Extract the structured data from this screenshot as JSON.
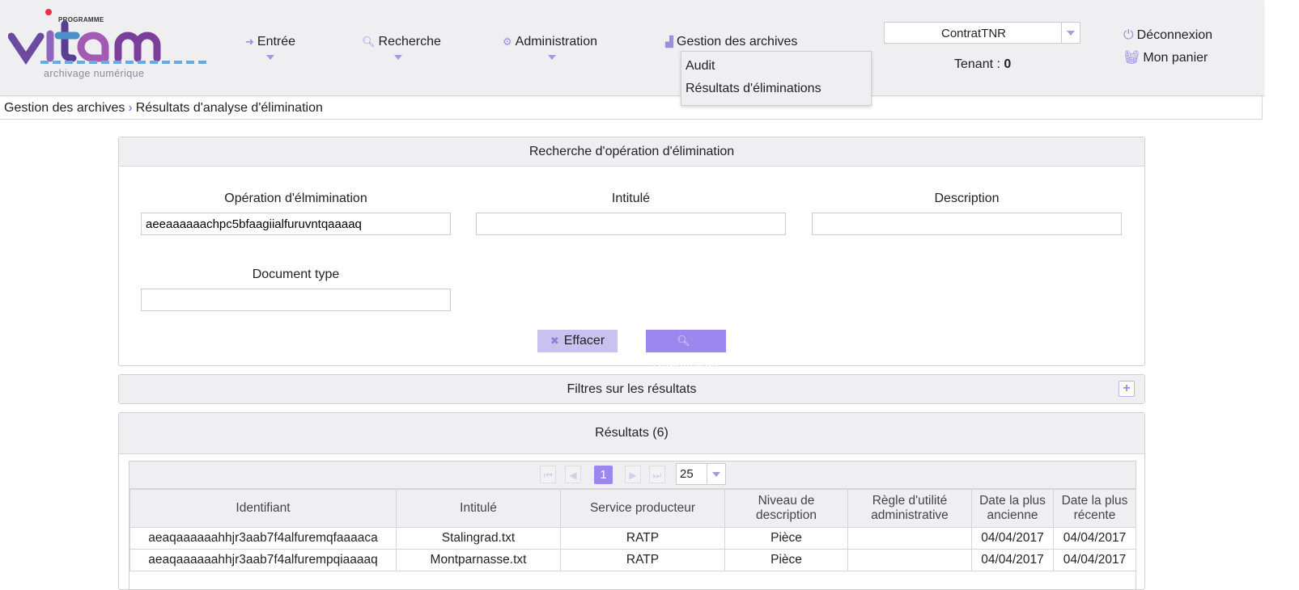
{
  "logo": {
    "program_label": "PROGRAMME",
    "brand": "vitam",
    "tagline": "archivage numérique"
  },
  "nav": {
    "items": [
      {
        "label": "Entrée",
        "icon": "sign-in-icon"
      },
      {
        "label": "Recherche",
        "icon": "search-icon"
      },
      {
        "label": "Administration",
        "icon": "gears-icon"
      },
      {
        "label": "Gestion des archives",
        "icon": "area-chart-icon"
      }
    ],
    "dropdown": [
      "Audit",
      "Résultats d'éliminations"
    ]
  },
  "header": {
    "contract": "ContratTNR",
    "tenant_label": "Tenant :",
    "tenant_value": "0",
    "logout": "Déconnexion",
    "cart": "Mon panier"
  },
  "breadcrumb": {
    "parent": "Gestion des archives",
    "current": "Résultats d'analyse d'élimination"
  },
  "search": {
    "title": "Recherche d'opération d'élimination",
    "operation_label": "Opération d'élmimination",
    "operation_value": "aeeaaaaaachpc5bfaagiialfuruvntqaaaaq",
    "title_label": "Intitulé",
    "title_value": "",
    "description_label": "Description",
    "description_value": "",
    "doctype_label": "Document type",
    "doctype_value": "",
    "clear_button": "Effacer",
    "search_button": "Rechercher"
  },
  "filters": {
    "title": "Filtres sur les résultats",
    "toggle": "+"
  },
  "results": {
    "title": "Résultats (6)",
    "current_page": "1",
    "page_size": "25",
    "columns": [
      "Identifiant",
      "Intitulé",
      "Service producteur",
      "Niveau de description",
      "Règle d'utilité administrative",
      "Date la plus ancienne",
      "Date la plus récente"
    ],
    "rows": [
      [
        "aeaqaaaaaahhjr3aab7f4alfuremqfaaaaca",
        "Stalingrad.txt",
        "RATP",
        "Pièce",
        "",
        "04/04/2017",
        "04/04/2017"
      ],
      [
        "aeaqaaaaaahhjr3aab7f4alfurempqiaaaaq",
        "Montparnasse.txt",
        "RATP",
        "Pièce",
        "",
        "04/04/2017",
        "04/04/2017"
      ]
    ]
  },
  "colors": {
    "accent": "#9b87ee",
    "accent_light": "#c9c1ee",
    "panel_bg": "#efeff1"
  }
}
